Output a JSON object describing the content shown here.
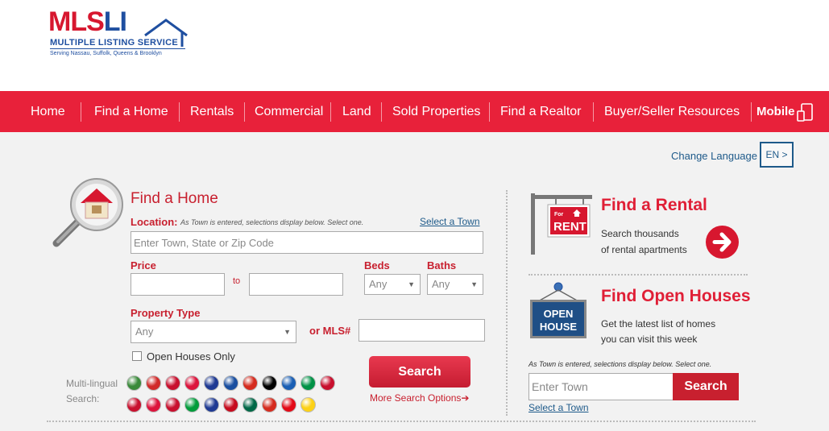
{
  "logo": {
    "mls": "MLS",
    "li": "LI",
    "subtitle": "MULTIPLE LISTING SERVICE",
    "tagline": "Serving Nassau, Suffolk, Queens & Brooklyn"
  },
  "nav": {
    "items": [
      "Home",
      "Find a Home",
      "Rentals",
      "Commercial",
      "Land",
      "Sold Properties",
      "Find a Realtor",
      "Buyer/Seller Resources"
    ],
    "mobile": "Mobile",
    "mobile_icon": "mobile-devices-icon"
  },
  "language": {
    "label": "Change Language",
    "button": "EN >"
  },
  "find_home": {
    "title": "Find a Home",
    "location_label": "Location:",
    "location_hint": "As Town is entered, selections display below. Select one.",
    "select_town": "Select a Town",
    "location_placeholder": "Enter Town, State or Zip Code",
    "price_label": "Price",
    "to_label": "to",
    "beds_label": "Beds",
    "beds_value": "Any",
    "baths_label": "Baths",
    "baths_value": "Any",
    "property_type_label": "Property Type",
    "property_type_value": "Any",
    "mls_label": "or MLS#",
    "open_houses_only": "Open Houses Only",
    "search_button": "Search",
    "more_options": "More Search Options➔",
    "multilingual_label_1": "Multi-lingual",
    "multilingual_label_2": "Search:"
  },
  "flags": {
    "row1": [
      "#3a8a3a",
      "#d12a2a",
      "#c8102e",
      "#dc143c",
      "#1f3a93",
      "#1a4fa0",
      "#d52b1e",
      "#000000",
      "#1a5fb4",
      "#009246",
      "#c8102e"
    ],
    "row2": [
      "#c8102e",
      "#dc143c",
      "#c8102e",
      "#009c3b",
      "#1f3a93",
      "#c60b1e",
      "#006847",
      "#d52b1e",
      "#e30a17",
      "#fcd116"
    ]
  },
  "rental": {
    "sign_top": "For",
    "sign_main": "RENT",
    "title": "Find a Rental",
    "line1": "Search thousands",
    "line2": "of rental apartments",
    "go_icon": "arrow-right-icon"
  },
  "open_houses": {
    "sign_line1": "OPEN",
    "sign_line2": "HOUSE",
    "title": "Find Open Houses",
    "line1": "Get the latest list of homes",
    "line2": "you can visit this week",
    "hint": "As Town is entered, selections display below. Select one.",
    "town_placeholder": "Enter Town",
    "search_button": "Search",
    "select_town": "Select a Town"
  },
  "colors": {
    "brand_red": "#e8213a",
    "brand_blue": "#1f4fa0",
    "link_blue": "#1e5a8a"
  }
}
